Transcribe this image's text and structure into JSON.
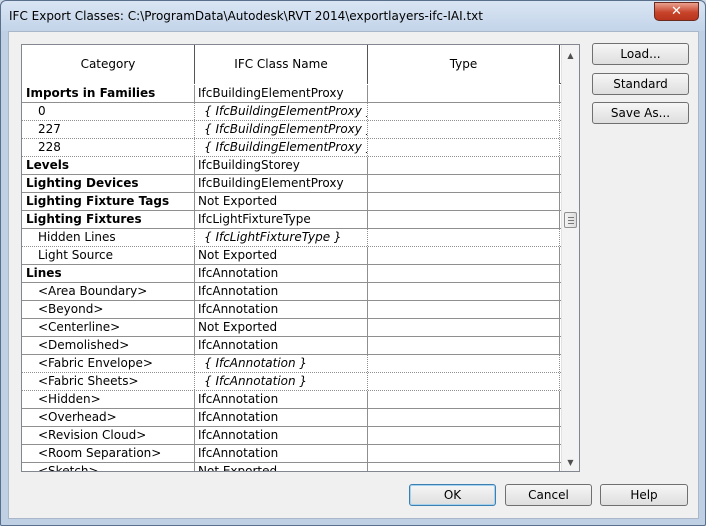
{
  "window": {
    "title": "IFC Export Classes: C:\\ProgramData\\Autodesk\\RVT 2014\\exportlayers-ifc-IAI.txt",
    "close_glyph": "✕"
  },
  "table": {
    "headers": {
      "category": "Category",
      "ifc_class": "IFC Class Name",
      "type": "Type"
    },
    "rows": [
      {
        "category": "Imports in Families",
        "ifc": "IfcBuildingElementProxy",
        "type": "",
        "bold": true,
        "indent": 0,
        "inherited": false
      },
      {
        "category": "0",
        "ifc": "{ IfcBuildingElementProxy }",
        "type": "",
        "bold": false,
        "indent": 1,
        "inherited": true
      },
      {
        "category": "227",
        "ifc": "{ IfcBuildingElementProxy }",
        "type": "",
        "bold": false,
        "indent": 1,
        "inherited": true
      },
      {
        "category": "228",
        "ifc": "{ IfcBuildingElementProxy }",
        "type": "",
        "bold": false,
        "indent": 1,
        "inherited": true
      },
      {
        "category": "Levels",
        "ifc": "IfcBuildingStorey",
        "type": "",
        "bold": true,
        "indent": 0,
        "inherited": false
      },
      {
        "category": "Lighting Devices",
        "ifc": "IfcBuildingElementProxy",
        "type": "",
        "bold": true,
        "indent": 0,
        "inherited": false
      },
      {
        "category": "Lighting Fixture Tags",
        "ifc": "Not Exported",
        "type": "",
        "bold": true,
        "indent": 0,
        "inherited": false
      },
      {
        "category": "Lighting Fixtures",
        "ifc": "IfcLightFixtureType",
        "type": "",
        "bold": true,
        "indent": 0,
        "inherited": false
      },
      {
        "category": "Hidden Lines",
        "ifc": "{ IfcLightFixtureType }",
        "type": "",
        "bold": false,
        "indent": 1,
        "inherited": true
      },
      {
        "category": "Light Source",
        "ifc": "Not Exported",
        "type": "",
        "bold": false,
        "indent": 1,
        "inherited": false
      },
      {
        "category": "Lines",
        "ifc": "IfcAnnotation",
        "type": "",
        "bold": true,
        "indent": 0,
        "inherited": false
      },
      {
        "category": "<Area Boundary>",
        "ifc": "IfcAnnotation",
        "type": "",
        "bold": false,
        "indent": 2,
        "inherited": false
      },
      {
        "category": "<Beyond>",
        "ifc": "IfcAnnotation",
        "type": "",
        "bold": false,
        "indent": 2,
        "inherited": false
      },
      {
        "category": "<Centerline>",
        "ifc": "Not Exported",
        "type": "",
        "bold": false,
        "indent": 2,
        "inherited": false
      },
      {
        "category": "<Demolished>",
        "ifc": "IfcAnnotation",
        "type": "",
        "bold": false,
        "indent": 2,
        "inherited": false
      },
      {
        "category": "<Fabric Envelope>",
        "ifc": "{ IfcAnnotation }",
        "type": "",
        "bold": false,
        "indent": 2,
        "inherited": true
      },
      {
        "category": "<Fabric Sheets>",
        "ifc": "{ IfcAnnotation }",
        "type": "",
        "bold": false,
        "indent": 2,
        "inherited": true
      },
      {
        "category": "<Hidden>",
        "ifc": "IfcAnnotation",
        "type": "",
        "bold": false,
        "indent": 2,
        "inherited": false
      },
      {
        "category": "<Overhead>",
        "ifc": "IfcAnnotation",
        "type": "",
        "bold": false,
        "indent": 2,
        "inherited": false
      },
      {
        "category": "<Revision Cloud>",
        "ifc": "IfcAnnotation",
        "type": "",
        "bold": false,
        "indent": 2,
        "inherited": false
      },
      {
        "category": "<Room Separation>",
        "ifc": "IfcAnnotation",
        "type": "",
        "bold": false,
        "indent": 2,
        "inherited": false
      },
      {
        "category": "<Sketch>",
        "ifc": "Not Exported",
        "type": "",
        "bold": false,
        "indent": 2,
        "inherited": false
      }
    ]
  },
  "scrollbar": {
    "up_glyph": "▲",
    "down_glyph": "▼"
  },
  "buttons": {
    "load": "Load...",
    "standard": "Standard",
    "save_as": "Save As...",
    "ok": "OK",
    "cancel": "Cancel",
    "help": "Help"
  },
  "colors": {
    "title_bar": "#c3d4e9",
    "close_button": "#c7442b",
    "dialog_bg": "#f0f0f0",
    "default_button_border": "#3c7fb1"
  }
}
